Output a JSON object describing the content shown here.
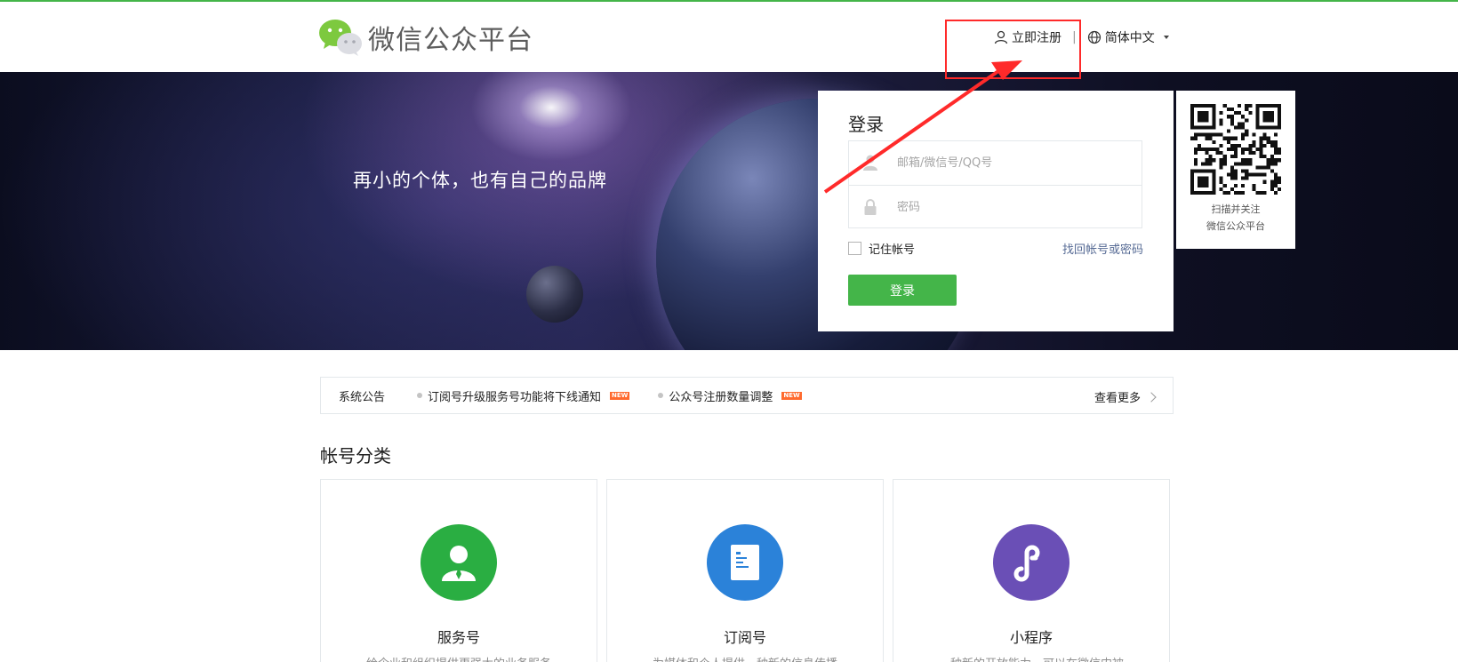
{
  "header": {
    "logo_text": "微信公众平台",
    "register_label": "立即注册",
    "separator": "|",
    "language_label": "简体中文"
  },
  "banner": {
    "slogan": "再小的个体，也有自己的品牌"
  },
  "login": {
    "title": "登录",
    "account_placeholder": "邮箱/微信号/QQ号",
    "password_placeholder": "密码",
    "remember_label": "记住帐号",
    "forgot_label": "找回帐号或密码",
    "submit_label": "登录"
  },
  "qr": {
    "line1": "扫描并关注",
    "line2": "微信公众平台"
  },
  "notice": {
    "label": "系统公告",
    "items": [
      {
        "text": "订阅号升级服务号功能将下线通知",
        "badge": "NEW"
      },
      {
        "text": "公众号注册数量调整",
        "badge": "NEW"
      }
    ],
    "more_label": "查看更多"
  },
  "categories": {
    "title": "帐号分类",
    "cards": [
      {
        "name": "服务号",
        "desc": "给企业和组织提供更强大的业务服务",
        "color": "#2aae42"
      },
      {
        "name": "订阅号",
        "desc": "为媒体和个人提供一种新的信息传播",
        "color": "#2b82d9"
      },
      {
        "name": "小程序",
        "desc": "一种新的开放能力，可以在微信内被",
        "color": "#6a4fb6"
      }
    ]
  },
  "colors": {
    "brand_green": "#44b549",
    "annotation_red": "#ff2a2a",
    "link_blue": "#576b95"
  }
}
